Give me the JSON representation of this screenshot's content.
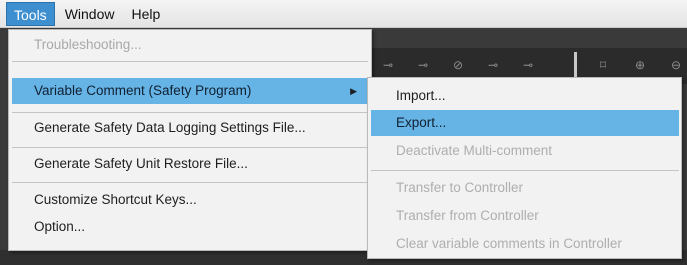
{
  "menubar": {
    "items": [
      {
        "label": "Tools"
      },
      {
        "label": "Window"
      },
      {
        "label": "Help"
      }
    ]
  },
  "toolbar_icons": [
    "ladder-icon-1",
    "ladder-icon-2",
    "ladder-icon-3",
    "ladder-icon-4",
    "ladder-icon-5",
    "fit-icon",
    "zoom-in-icon",
    "zoom-out-icon"
  ],
  "tools_menu": {
    "items": [
      {
        "label": "Troubleshooting...",
        "disabled": true
      },
      {
        "label": "Variable Comment (Safety Program)",
        "submenu_arrow": "▶"
      },
      {
        "label": "Generate Safety Data Logging Settings File..."
      },
      {
        "label": "Generate Safety Unit Restore File..."
      },
      {
        "label": "Customize Shortcut Keys..."
      },
      {
        "label": "Option..."
      }
    ]
  },
  "submenu": {
    "items": [
      {
        "label": "Import..."
      },
      {
        "label": "Export..."
      },
      {
        "label": "Deactivate Multi-comment",
        "disabled": true
      },
      {
        "label": "Transfer to Controller",
        "disabled": true
      },
      {
        "label": "Transfer from Controller",
        "disabled": true
      },
      {
        "label": "Clear variable comments in Controller",
        "disabled": true
      }
    ]
  },
  "colors": {
    "highlight": "#66b3e6",
    "menubar_active": "#3e8fd0",
    "disabled_text": "#a9a9a9"
  }
}
